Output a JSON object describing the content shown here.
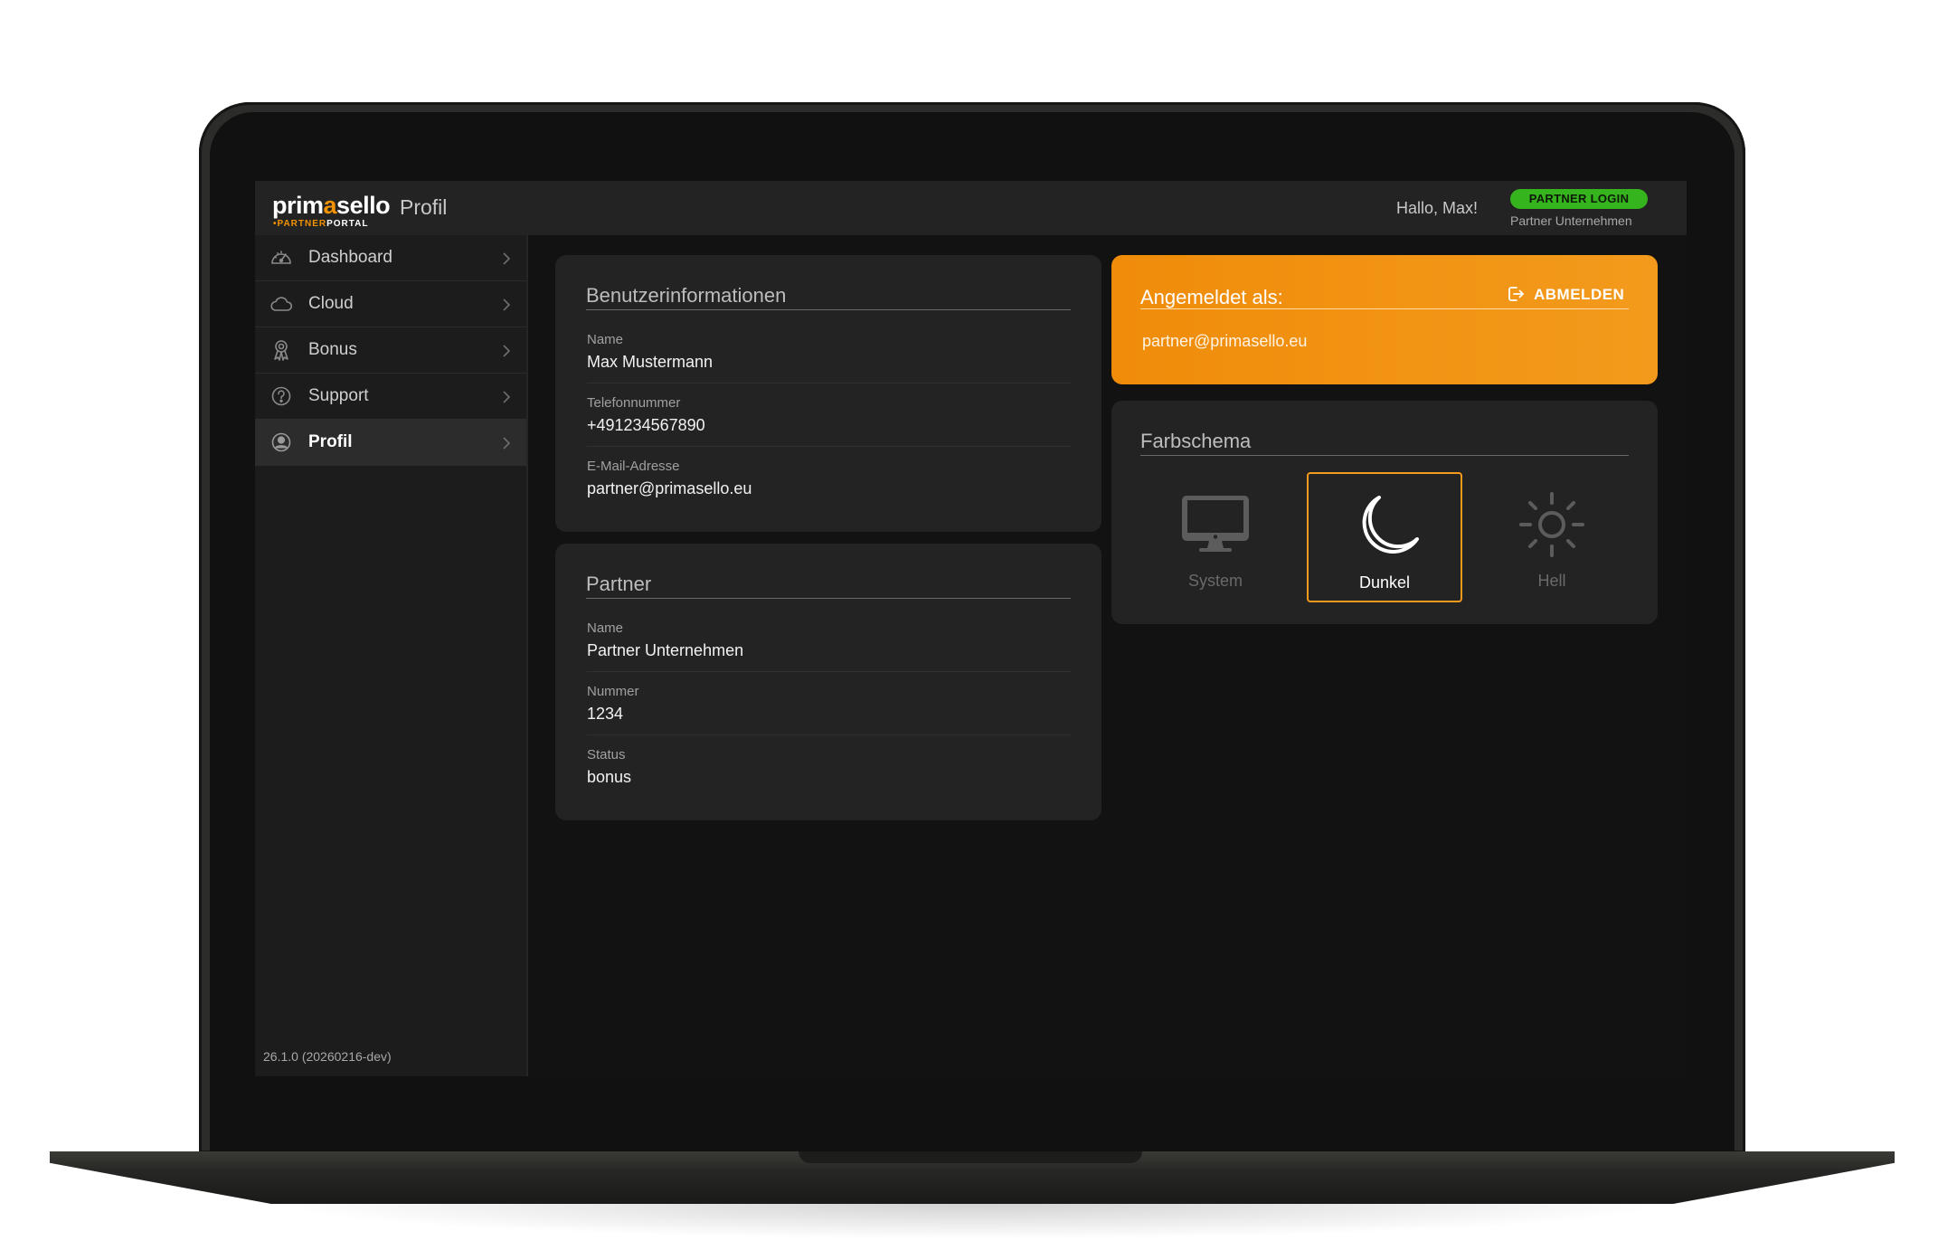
{
  "header": {
    "logo_main_a": "prim",
    "logo_main_accent": "a",
    "logo_main_b": "sello",
    "logo_sub_dot": "•",
    "logo_sub_partner": "PARTNER",
    "logo_sub_portal": "PORTAL",
    "page_title": "Profil",
    "greeting": "Hallo, Max!",
    "login_badge": "PARTNER LOGIN",
    "company": "Partner Unternehmen"
  },
  "sidebar": {
    "items": [
      {
        "label": "Dashboard",
        "icon": "gauge-icon"
      },
      {
        "label": "Cloud",
        "icon": "cloud-icon"
      },
      {
        "label": "Bonus",
        "icon": "award-icon"
      },
      {
        "label": "Support",
        "icon": "help-icon"
      },
      {
        "label": "Profil",
        "icon": "user-icon",
        "active": true
      }
    ],
    "version": "26.1.0 (20260216-dev)"
  },
  "user_info": {
    "title": "Benutzerinformationen",
    "fields": [
      {
        "label": "Name",
        "value": "Max Mustermann"
      },
      {
        "label": "Telefonnummer",
        "value": "+491234567890"
      },
      {
        "label": "E-Mail-Adresse",
        "value": "partner@primasello.eu"
      }
    ]
  },
  "partner": {
    "title": "Partner",
    "fields": [
      {
        "label": "Name",
        "value": "Partner Unternehmen"
      },
      {
        "label": "Nummer",
        "value": "1234"
      },
      {
        "label": "Status",
        "value": "bonus"
      }
    ]
  },
  "account": {
    "title": "Angemeldet als:",
    "logout_label": "ABMELDEN",
    "email": "partner@primasello.eu"
  },
  "color_scheme": {
    "title": "Farbschema",
    "options": [
      {
        "label": "System",
        "icon": "monitor-icon"
      },
      {
        "label": "Dunkel",
        "icon": "moon-icon",
        "selected": true
      },
      {
        "label": "Hell",
        "icon": "sun-icon"
      }
    ]
  },
  "colors": {
    "accent": "#f39200",
    "login_badge": "#36b41e",
    "background": "#121212",
    "card": "#232323"
  }
}
